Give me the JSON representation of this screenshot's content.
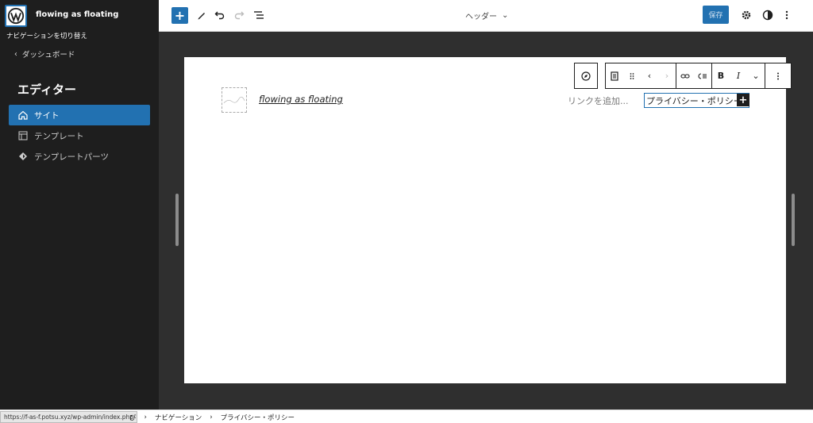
{
  "sidebar": {
    "site_name": "flowing as floating",
    "nav_toggle": "ナビゲーションを切り替え",
    "back_label": "ダッシュボード",
    "title": "エディター",
    "items": [
      {
        "label": "サイト",
        "icon": "home-icon",
        "active": true
      },
      {
        "label": "テンプレート",
        "icon": "layout-icon",
        "active": false
      },
      {
        "label": "テンプレートパーツ",
        "icon": "symbol-icon",
        "active": false
      }
    ]
  },
  "topbar": {
    "doc_title": "ヘッダー",
    "save_label": "保存"
  },
  "canvas": {
    "site_title": "flowing as floating",
    "add_link": "リンクを追加...",
    "nav_item": "プライバシー・ポリシー"
  },
  "block_toolbar": {
    "bold": "B",
    "italic": "I"
  },
  "footer": {
    "url": "https://f-as-f.potsu.xyz/wp-admin/index.php",
    "crumb_partial": "び",
    "crumbs": [
      "ナビゲーション",
      "プライバシー・ポリシー"
    ]
  },
  "colors": {
    "accent": "#2271b1",
    "sidebar_bg": "#1e1e1e",
    "canvas_bg": "#2f2f2f"
  }
}
